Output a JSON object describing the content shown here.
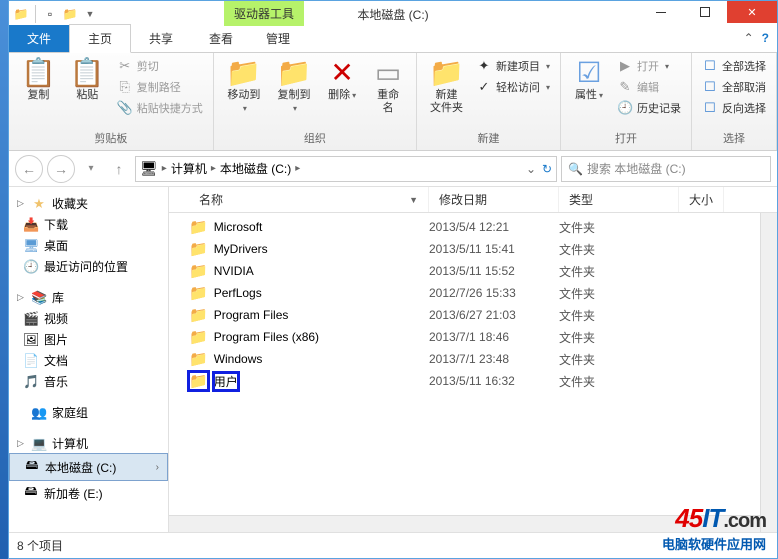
{
  "window": {
    "title": "本地磁盘 (C:)",
    "contextual_tab": "驱动器工具"
  },
  "ribbon_tabs": {
    "file": "文件",
    "home": "主页",
    "share": "共享",
    "view": "查看",
    "manage": "管理"
  },
  "ribbon": {
    "clipboard": {
      "label": "剪贴板",
      "copy": "复制",
      "paste": "粘贴",
      "cut": "剪切",
      "copypath": "复制路径",
      "pasteshortcut": "粘贴快捷方式"
    },
    "organize": {
      "label": "组织",
      "moveto": "移动到",
      "copyto": "复制到",
      "delete": "删除",
      "rename": "重命名"
    },
    "new": {
      "label": "新建",
      "newfolder": "新建\n文件夹",
      "newitem": "新建项目",
      "easyaccess": "轻松访问"
    },
    "open": {
      "label": "打开",
      "properties": "属性",
      "open": "打开",
      "edit": "编辑",
      "history": "历史记录"
    },
    "select": {
      "label": "选择",
      "all": "全部选择",
      "none": "全部取消",
      "invert": "反向选择"
    }
  },
  "breadcrumb": {
    "computer": "计算机",
    "drive": "本地磁盘 (C:)"
  },
  "search": {
    "placeholder": "搜索 本地磁盘 (C:)"
  },
  "sidebar": {
    "favorites": {
      "label": "收藏夹",
      "items": [
        "下载",
        "桌面",
        "最近访问的位置"
      ]
    },
    "libraries": {
      "label": "库",
      "items": [
        "视频",
        "图片",
        "文档",
        "音乐"
      ]
    },
    "homegroup": "家庭组",
    "computer": {
      "label": "计算机",
      "items": [
        "本地磁盘 (C:)",
        "新加卷 (E:)"
      ]
    }
  },
  "columns": {
    "name": "名称",
    "date": "修改日期",
    "type": "类型",
    "size": "大小"
  },
  "files": [
    {
      "name": "Microsoft",
      "date": "2013/5/4 12:21",
      "type": "文件夹"
    },
    {
      "name": "MyDrivers",
      "date": "2013/5/11 15:41",
      "type": "文件夹"
    },
    {
      "name": "NVIDIA",
      "date": "2013/5/11 15:52",
      "type": "文件夹"
    },
    {
      "name": "PerfLogs",
      "date": "2012/7/26 15:33",
      "type": "文件夹"
    },
    {
      "name": "Program Files",
      "date": "2013/6/27 21:03",
      "type": "文件夹"
    },
    {
      "name": "Program Files (x86)",
      "date": "2013/7/1 18:46",
      "type": "文件夹"
    },
    {
      "name": "Windows",
      "date": "2013/7/1 23:48",
      "type": "文件夹"
    },
    {
      "name": "用户",
      "date": "2013/5/11 16:32",
      "type": "文件夹",
      "highlight": true
    }
  ],
  "status": {
    "count": "8 个项目"
  },
  "watermark": {
    "brand_num": "45",
    "brand_txt": "IT",
    "brand_dom": ".com",
    "sub": "电脑软硬件应用网"
  }
}
